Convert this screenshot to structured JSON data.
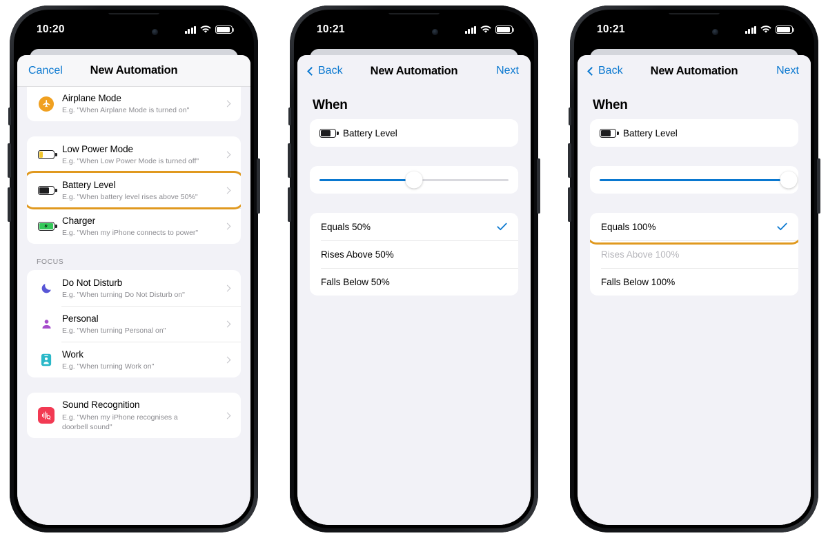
{
  "colors": {
    "accent_blue": "#0a78d0",
    "highlight_orange": "#e0991f",
    "sheet_bg": "#f2f2f7",
    "card_white": "#ffffff",
    "subtitle_gray": "#8b8b90"
  },
  "phones": [
    {
      "id": "phone-1",
      "status_bar": {
        "time": "10:20",
        "signal": "signal-icon",
        "wifi": "wifi-icon",
        "battery": "battery-icon"
      },
      "nav": {
        "left_label": "Cancel",
        "title": "New Automation",
        "right_label": ""
      },
      "groups": [
        {
          "header": "",
          "rows": [
            {
              "title": "Airplane Mode",
              "subtitle": "E.g. \"When Airplane Mode is turned on\"",
              "icon": "airplane-icon",
              "icon_color": "#f0a020",
              "highlighted": false
            }
          ]
        },
        {
          "header": "",
          "rows": [
            {
              "title": "Low Power Mode",
              "subtitle": "E.g. \"When Low Power Mode is turned off\"",
              "icon": "low-battery-icon",
              "icon_color": "#f2c72e",
              "highlighted": false
            },
            {
              "title": "Battery Level",
              "subtitle": "E.g. \"When battery level rises above 50%\"",
              "icon": "battery-level-icon",
              "icon_color": "#1d1d1f",
              "highlighted": true
            },
            {
              "title": "Charger",
              "subtitle": "E.g. \"When my iPhone connects to power\"",
              "icon": "charging-battery-icon",
              "icon_color": "#34c759",
              "highlighted": false
            }
          ]
        },
        {
          "header": "FOCUS",
          "rows": [
            {
              "title": "Do Not Disturb",
              "subtitle": "E.g. \"When turning Do Not Disturb on\"",
              "icon": "moon-icon",
              "icon_color": "#5856d6",
              "highlighted": false
            },
            {
              "title": "Personal",
              "subtitle": "E.g. \"When turning Personal on\"",
              "icon": "person-icon",
              "icon_color": "#a64ccb",
              "highlighted": false
            },
            {
              "title": "Work",
              "subtitle": "E.g. \"When turning Work on\"",
              "icon": "id-badge-icon",
              "icon_color": "#2ab8c8",
              "highlighted": false
            }
          ]
        },
        {
          "header": "",
          "rows": [
            {
              "title": "Sound Recognition",
              "subtitle": "E.g. \"When my iPhone recognises a doorbell sound\"",
              "icon": "sound-recognition-icon",
              "icon_color": "#f23a53",
              "highlighted": false
            }
          ]
        }
      ]
    },
    {
      "id": "phone-2",
      "status_bar": {
        "time": "10:21",
        "signal": "signal-icon",
        "wifi": "wifi-icon",
        "battery": "battery-icon"
      },
      "nav": {
        "left_label": "Back",
        "title": "New Automation",
        "right_label": "Next"
      },
      "section_title": "When",
      "trigger": {
        "label": "Battery Level",
        "icon": "battery-level-icon"
      },
      "slider": {
        "value": 50,
        "min": 0,
        "max": 100,
        "fill_color": "#0a78d0"
      },
      "options": [
        {
          "label": "Equals 50%",
          "checked": true,
          "dimmed": false,
          "highlighted": false
        },
        {
          "label": "Rises Above 50%",
          "checked": false,
          "dimmed": false,
          "highlighted": false
        },
        {
          "label": "Falls Below 50%",
          "checked": false,
          "dimmed": false,
          "highlighted": false
        }
      ]
    },
    {
      "id": "phone-3",
      "status_bar": {
        "time": "10:21",
        "signal": "signal-icon",
        "wifi": "wifi-icon",
        "battery": "battery-icon"
      },
      "nav": {
        "left_label": "Back",
        "title": "New Automation",
        "right_label": "Next"
      },
      "section_title": "When",
      "trigger": {
        "label": "Battery Level",
        "icon": "battery-level-icon"
      },
      "slider": {
        "value": 100,
        "min": 0,
        "max": 100,
        "fill_color": "#0a78d0"
      },
      "options": [
        {
          "label": "Equals 100%",
          "checked": true,
          "dimmed": false,
          "highlighted": true
        },
        {
          "label": "Rises Above 100%",
          "checked": false,
          "dimmed": true,
          "highlighted": false
        },
        {
          "label": "Falls Below 100%",
          "checked": false,
          "dimmed": false,
          "highlighted": false
        }
      ]
    }
  ]
}
